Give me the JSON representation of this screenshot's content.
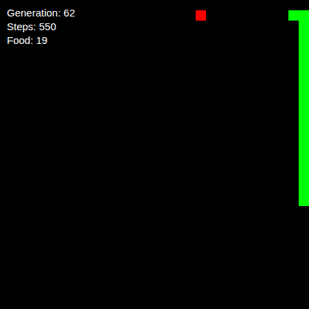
{
  "stats": [
    "Generation: 62",
    "Steps: 550",
    "Food: 19"
  ],
  "food": {
    "cell": [
      19,
      1
    ],
    "color": "#ff0000"
  },
  "snake": {
    "color": "#00ff00",
    "segments": [
      [
        28,
        1
      ],
      [
        29,
        1
      ],
      [
        29,
        2
      ],
      [
        29,
        3
      ],
      [
        29,
        4
      ],
      [
        29,
        5
      ],
      [
        29,
        6
      ],
      [
        29,
        7
      ],
      [
        29,
        8
      ],
      [
        29,
        9
      ],
      [
        29,
        10
      ],
      [
        29,
        11
      ],
      [
        29,
        12
      ],
      [
        29,
        13
      ],
      [
        29,
        14
      ],
      [
        29,
        15
      ],
      [
        29,
        16
      ],
      [
        29,
        17
      ],
      [
        29,
        18
      ],
      [
        29,
        19
      ]
    ]
  }
}
